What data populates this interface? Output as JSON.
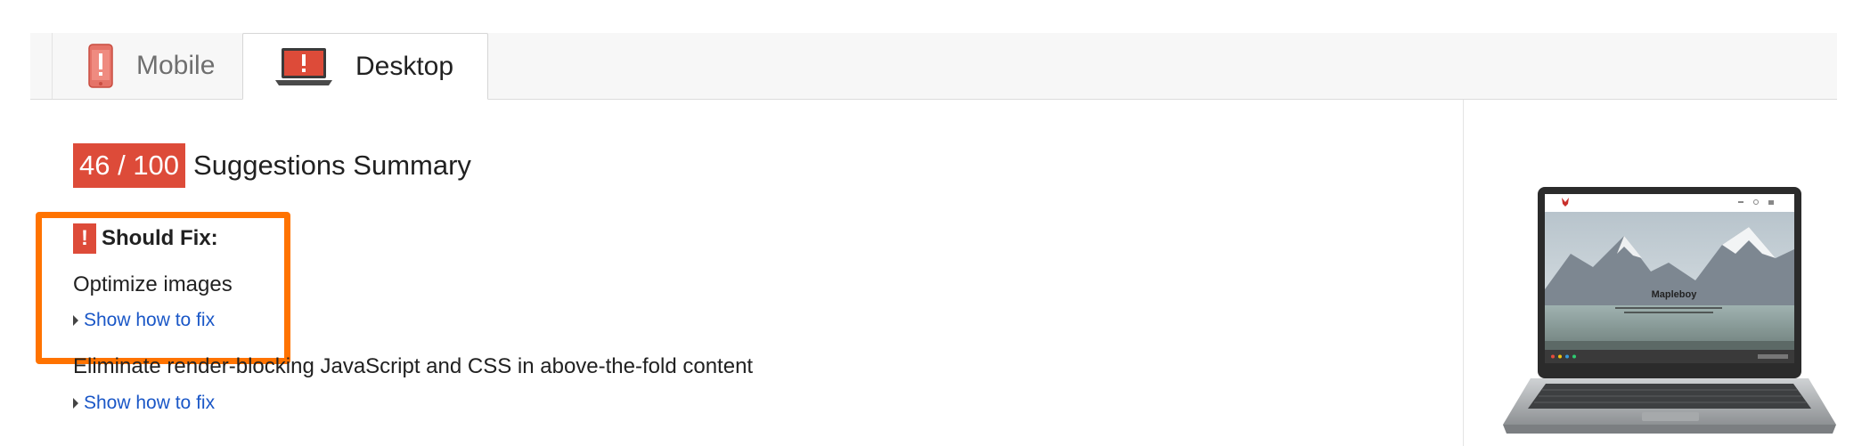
{
  "tabs": [
    {
      "label": "Mobile",
      "icon": "mobile-phone-icon",
      "active": false
    },
    {
      "label": "Desktop",
      "icon": "laptop-icon",
      "active": true
    }
  ],
  "summary": {
    "score": "46 / 100",
    "title": "Suggestions Summary"
  },
  "should_fix": {
    "label": "Should Fix:",
    "icon": "exclamation-icon"
  },
  "rules": [
    {
      "title": "Optimize images",
      "link": "Show how to fix"
    },
    {
      "title": "Eliminate render-blocking JavaScript and CSS in above-the-fold content",
      "link": "Show how to fix"
    }
  ],
  "preview": {
    "brand": "Mapleboy"
  },
  "colors": {
    "score_red": "#dd4b39",
    "link_blue": "#1a57c7",
    "highlight_orange": "#ff7300"
  }
}
